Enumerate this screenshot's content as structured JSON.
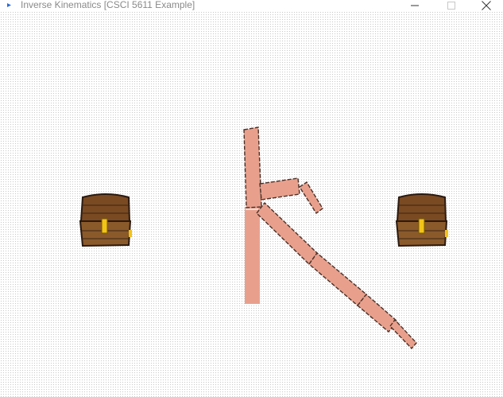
{
  "window": {
    "title": "Inverse Kinematics [CSCI 5611 Example]",
    "icons": {
      "app": "app-icon",
      "minimize": "minimize-icon",
      "maximize": "maximize-icon",
      "close": "close-icon"
    }
  },
  "scene": {
    "colors": {
      "arm_fill": "#e8a08c",
      "arm_outline": "#4a3028",
      "chest_wood": "#8b5a2b",
      "chest_lid": "#7a4a22",
      "chest_outline": "#2b1a10",
      "chest_latch": "#f2c418"
    },
    "objects": [
      "treasure-chest-left",
      "treasure-chest-right",
      "ik-arm-base",
      "ik-arm-upper-chain",
      "ik-arm-lower-chain"
    ]
  }
}
